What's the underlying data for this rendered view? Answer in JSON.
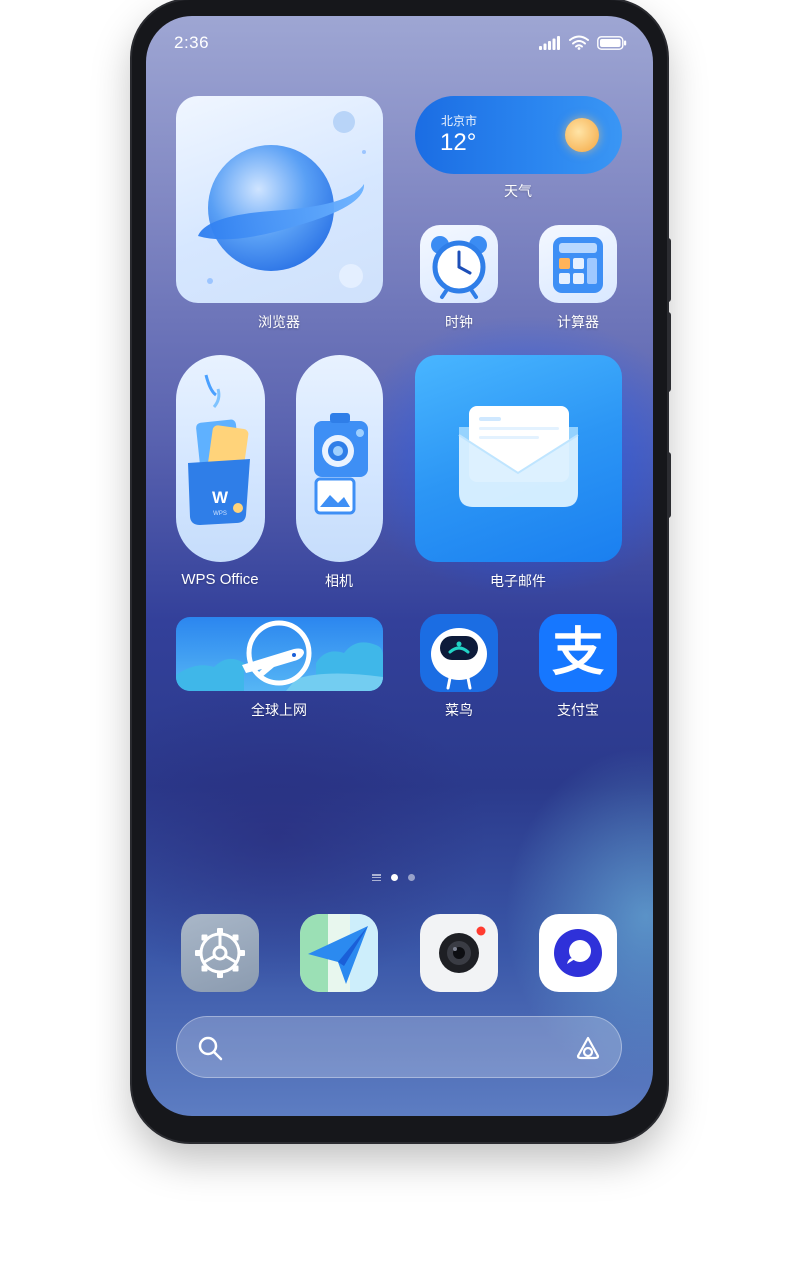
{
  "status_bar": {
    "time": "2:36",
    "icons": [
      "signal-icon",
      "wifi-icon",
      "battery-icon"
    ]
  },
  "widgets": {
    "browser": {
      "label": "浏览器"
    },
    "weather": {
      "city": "北京市",
      "temp": "12°",
      "label": "天气"
    },
    "wps": {
      "label": "WPS Office",
      "logo_text": "W",
      "sub_text": "WPS"
    },
    "camera": {
      "label": "相机"
    },
    "mail": {
      "label": "电子邮件"
    },
    "global": {
      "label": "全球上网"
    }
  },
  "apps": {
    "clock": {
      "label": "时钟"
    },
    "calculator": {
      "label": "计算器"
    },
    "cainiao": {
      "label": "菜鸟"
    },
    "alipay": {
      "label": "支付宝",
      "glyph": "支"
    }
  },
  "pager": {
    "pages": 2,
    "current": 1
  },
  "dock": [
    "settings-icon",
    "navigation-icon",
    "camera-app-icon",
    "browser-circle-icon"
  ],
  "search": {
    "left_icon": "search-icon",
    "right_icon": "assistant-icon"
  },
  "colors": {
    "accent": "#1b6de3",
    "alipay_blue": "#1677ff",
    "cainiao_blue": "#1b6de3"
  }
}
